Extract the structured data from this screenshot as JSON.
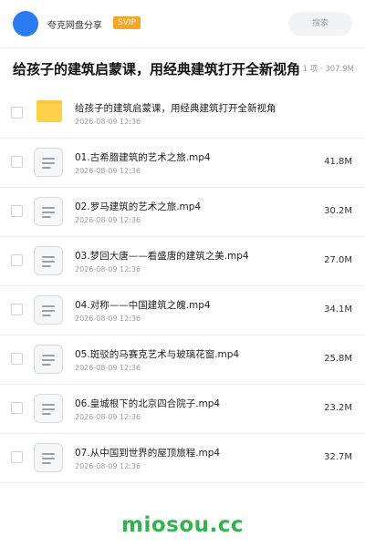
{
  "header": {
    "username": "夸克网盘分享",
    "vip_badge": "SVIP",
    "search_placeholder": "搜索"
  },
  "share": {
    "title": "给孩子的建筑启蒙课，用经典建筑打开全新视角",
    "summary": "11 项 · 307.9M"
  },
  "files": [
    {
      "type": "folder",
      "name": "给孩子的建筑启蒙课，用经典建筑打开全新视角",
      "date": "2026-08-09 12:36",
      "size": ""
    },
    {
      "type": "file",
      "name": "01.古希腊建筑的艺术之旅.mp4",
      "date": "2026-08-09 12:36",
      "size": "41.8M"
    },
    {
      "type": "file",
      "name": "02.罗马建筑的艺术之旅.mp4",
      "date": "2026-08-09 12:36",
      "size": "30.2M"
    },
    {
      "type": "file",
      "name": "03.梦回大唐——看盛唐的建筑之美.mp4",
      "date": "2026-08-09 12:36",
      "size": "27.0M"
    },
    {
      "type": "file",
      "name": "04.对称——中国建筑之魄.mp4",
      "date": "2026-08-09 12:36",
      "size": "34.1M"
    },
    {
      "type": "file",
      "name": "05.斑驳的马赛克艺术与玻璃花窗.mp4",
      "date": "2026-08-09 12:36",
      "size": "25.8M"
    },
    {
      "type": "file",
      "name": "06.皇城根下的北京四合院子.mp4",
      "date": "2026-08-09 12:36",
      "size": "23.2M"
    },
    {
      "type": "file",
      "name": "07.从中国到世界的屋顶旅程.mp4",
      "date": "2026-08-09 12:36",
      "size": "32.7M"
    }
  ],
  "watermark": "miosou.cc",
  "colors": {
    "accent": "#2b7bf3",
    "vip": "#f6a623",
    "folder": "#fcd24a",
    "watermark": "#33b34f"
  }
}
